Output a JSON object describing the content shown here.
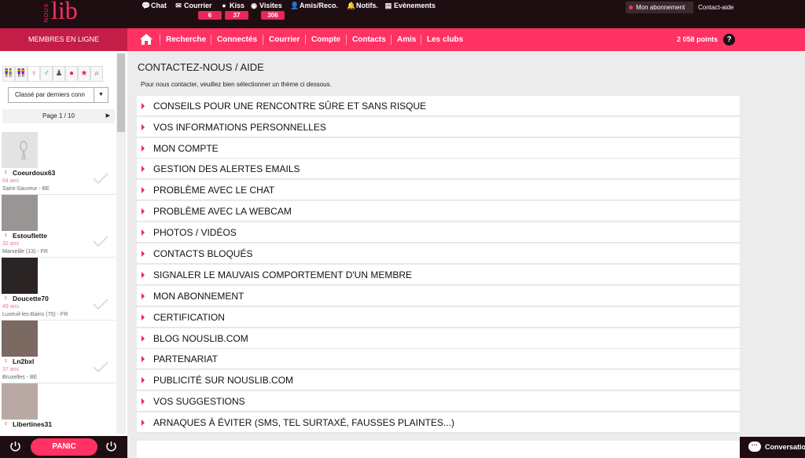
{
  "logo": {
    "small": "NOUS",
    "big": "lib"
  },
  "topnav": [
    {
      "icon": "chat-icon",
      "label": "Chat"
    },
    {
      "icon": "mail-icon",
      "label": "Courrier",
      "badge": "6"
    },
    {
      "icon": "kiss-icon",
      "label": "Kiss",
      "badge": "37"
    },
    {
      "icon": "eye-icon",
      "label": "Visites",
      "badge": "306"
    },
    {
      "icon": "user-icon",
      "label": "Amis/Reco."
    },
    {
      "icon": "bell-icon",
      "label": "Notifs."
    },
    {
      "icon": "calendar-icon",
      "label": "Evènements"
    }
  ],
  "account": {
    "abonnement": "Mon abonnement",
    "contact": "Contact-aide"
  },
  "sidebar": {
    "title": "MEMBRES EN LIGNE",
    "sort": "Classé par derniers conn",
    "pager": "Page 1 / 10",
    "members": [
      {
        "name": "Coeurdoux63",
        "age": "64 ans",
        "location": "Saint-Sauveur - BE"
      },
      {
        "name": "Estouflette",
        "age": "32 ans",
        "location": "Marseille (13) - FR"
      },
      {
        "name": "Doucette70",
        "age": "49 ans",
        "location": "Luxeuil-les-Bains (70) - FR"
      },
      {
        "name": "Ln2bxl",
        "age": "37 ans",
        "location": "Bruxelles - BE"
      },
      {
        "name": "Libertines31",
        "age": "",
        "location": ""
      }
    ],
    "panic": "PANIC"
  },
  "mainnav": {
    "items": [
      "Recherche",
      "Connectés",
      "Courrier",
      "Compte",
      "Contacts",
      "Amis",
      "Les clubs"
    ],
    "points": "2 058 points",
    "help": "?"
  },
  "content": {
    "title": "CONTACTEZ-NOUS / AIDE",
    "intro": "Pour nous contacter, veuillez bien sélectionner un thème ci dessous.",
    "topics": [
      "CONSEILS POUR UNE RENCONTRE SÛRE ET SANS RISQUE",
      "VOS INFORMATIONS PERSONNELLES",
      "MON COMPTE",
      "GESTION DES ALERTES EMAILS",
      "PROBLÈME AVEC LE CHAT",
      "PROBLÈME AVEC LA WEBCAM",
      "PHOTOS / VIDÉOS",
      "CONTACTS BLOQUÉS",
      "SIGNALER LE MAUVAIS COMPORTEMENT D'UN MEMBRE",
      "MON ABONNEMENT",
      "CERTIFICATION",
      "BLOG NOUSLIB.COM",
      "PARTENARIAT",
      "PUBLICITÉ SUR NOUSLIB.COM",
      "VOS SUGGESTIONS",
      "ARNAQUES À ÉVITER (SMS, TEL SURTAXÉ, FAUSSES PLAINTES...)"
    ]
  },
  "conversation": "Conversation"
}
